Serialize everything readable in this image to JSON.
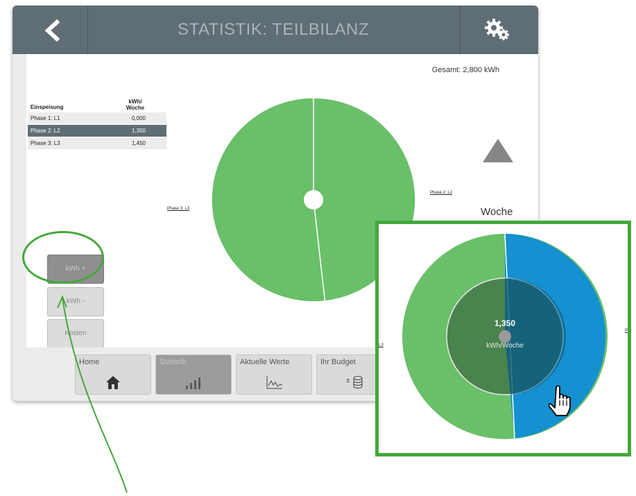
{
  "header": {
    "title": "STATISTIK: TEILBILANZ",
    "back_icon": "chevron-left-icon",
    "settings_icon": "gears-icon"
  },
  "total": "Gesamt: 2,800 kWh",
  "table": {
    "col1": "Einspeisung",
    "col2_line1": "kWh/",
    "col2_line2": "Woche",
    "rows": [
      {
        "label": "Phase 1: L1",
        "value": "0,000"
      },
      {
        "label": "Phase 2: L2",
        "value": "1,350",
        "selected": true
      },
      {
        "label": "Phase 3: L3",
        "value": "1,450"
      }
    ]
  },
  "chart_labels": {
    "left": "Phase 3: L3",
    "right": "Phase 2: L2"
  },
  "period": "Woche",
  "side_buttons": {
    "kwh_plus": "kWh +",
    "kwh_minus": "kWh -",
    "kosten": "Kosten"
  },
  "nav": {
    "home": "Home",
    "statistik": "Statistik",
    "aktuelle_werte": "Aktuelle Werte",
    "ihr_budget": "Ihr Budget"
  },
  "zoom": {
    "value": "1,350",
    "unit": "kWh/Woche",
    "left_fragment": "L3",
    "right_fragment": "P"
  },
  "chart_data": {
    "type": "pie",
    "categories": [
      "Phase 1: L1",
      "Phase 2: L2",
      "Phase 3: L3"
    ],
    "values": [
      0.0,
      1.35,
      1.45
    ],
    "unit": "kWh/Woche",
    "total": 2.8
  },
  "colors": {
    "header": "#5f6e74",
    "pie_green": "#6abf69",
    "highlight_blue": "#1590d0",
    "annotation_green": "#44a83b",
    "selected_row": "#5f6e74"
  }
}
